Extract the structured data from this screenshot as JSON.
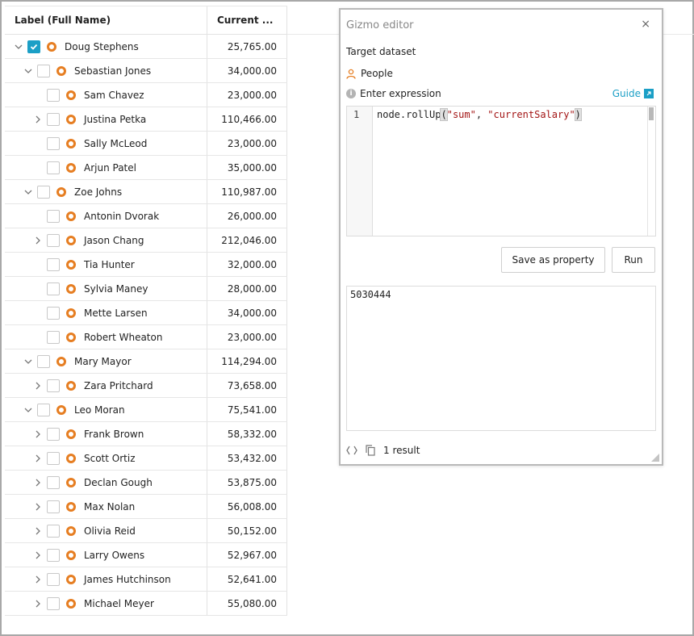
{
  "table": {
    "col_label": "Label (Full Name)",
    "col_value": "Current ...",
    "rows": [
      {
        "name": "Doug Stephens",
        "value": "25,765.00",
        "level": 0,
        "chevron": "down",
        "checked": true
      },
      {
        "name": "Sebastian Jones",
        "value": "34,000.00",
        "level": 1,
        "chevron": "down",
        "checked": false
      },
      {
        "name": "Sam Chavez",
        "value": "23,000.00",
        "level": 2,
        "chevron": "none",
        "checked": false
      },
      {
        "name": "Justina Petka",
        "value": "110,466.00",
        "level": 2,
        "chevron": "right",
        "checked": false
      },
      {
        "name": "Sally McLeod",
        "value": "23,000.00",
        "level": 2,
        "chevron": "none",
        "checked": false
      },
      {
        "name": "Arjun Patel",
        "value": "35,000.00",
        "level": 2,
        "chevron": "none",
        "checked": false
      },
      {
        "name": "Zoe Johns",
        "value": "110,987.00",
        "level": 1,
        "chevron": "down",
        "checked": false
      },
      {
        "name": "Antonin Dvorak",
        "value": "26,000.00",
        "level": 2,
        "chevron": "none",
        "checked": false
      },
      {
        "name": "Jason Chang",
        "value": "212,046.00",
        "level": 2,
        "chevron": "right",
        "checked": false
      },
      {
        "name": "Tia Hunter",
        "value": "32,000.00",
        "level": 2,
        "chevron": "none",
        "checked": false
      },
      {
        "name": "Sylvia Maney",
        "value": "28,000.00",
        "level": 2,
        "chevron": "none",
        "checked": false
      },
      {
        "name": "Mette Larsen",
        "value": "34,000.00",
        "level": 2,
        "chevron": "none",
        "checked": false
      },
      {
        "name": "Robert Wheaton",
        "value": "23,000.00",
        "level": 2,
        "chevron": "none",
        "checked": false
      },
      {
        "name": "Mary Mayor",
        "value": "114,294.00",
        "level": 1,
        "chevron": "down",
        "checked": false
      },
      {
        "name": "Zara Pritchard",
        "value": "73,658.00",
        "level": 2,
        "chevron": "right",
        "checked": false
      },
      {
        "name": "Leo Moran",
        "value": "75,541.00",
        "level": 1,
        "chevron": "down",
        "checked": false
      },
      {
        "name": "Frank Brown",
        "value": "58,332.00",
        "level": 2,
        "chevron": "right",
        "checked": false
      },
      {
        "name": "Scott Ortiz",
        "value": "53,432.00",
        "level": 2,
        "chevron": "right",
        "checked": false
      },
      {
        "name": "Declan Gough",
        "value": "53,875.00",
        "level": 2,
        "chevron": "right",
        "checked": false
      },
      {
        "name": "Max Nolan",
        "value": "56,008.00",
        "level": 2,
        "chevron": "right",
        "checked": false
      },
      {
        "name": "Olivia Reid",
        "value": "50,152.00",
        "level": 2,
        "chevron": "right",
        "checked": false
      },
      {
        "name": "Larry Owens",
        "value": "52,967.00",
        "level": 2,
        "chevron": "right",
        "checked": false
      },
      {
        "name": "James Hutchinson",
        "value": "52,641.00",
        "level": 2,
        "chevron": "right",
        "checked": false
      },
      {
        "name": "Michael Meyer",
        "value": "55,080.00",
        "level": 2,
        "chevron": "right",
        "checked": false
      }
    ]
  },
  "editor": {
    "title": "Gizmo editor",
    "close": "×",
    "target_label": "Target dataset",
    "dataset": "People",
    "expression_label": "Enter expression",
    "guide_label": "Guide",
    "line_number": "1",
    "code_prefix": "node.rollUp",
    "code_open": "(",
    "code_arg1": "\"sum\"",
    "code_sep": ", ",
    "code_arg2": "\"currentSalary\"",
    "code_close": ")",
    "save_label": "Save as property",
    "run_label": "Run",
    "result": "5030444",
    "result_count": "1 result"
  },
  "colors": {
    "accent": "#1b9fc6",
    "node": "#e67e22"
  }
}
